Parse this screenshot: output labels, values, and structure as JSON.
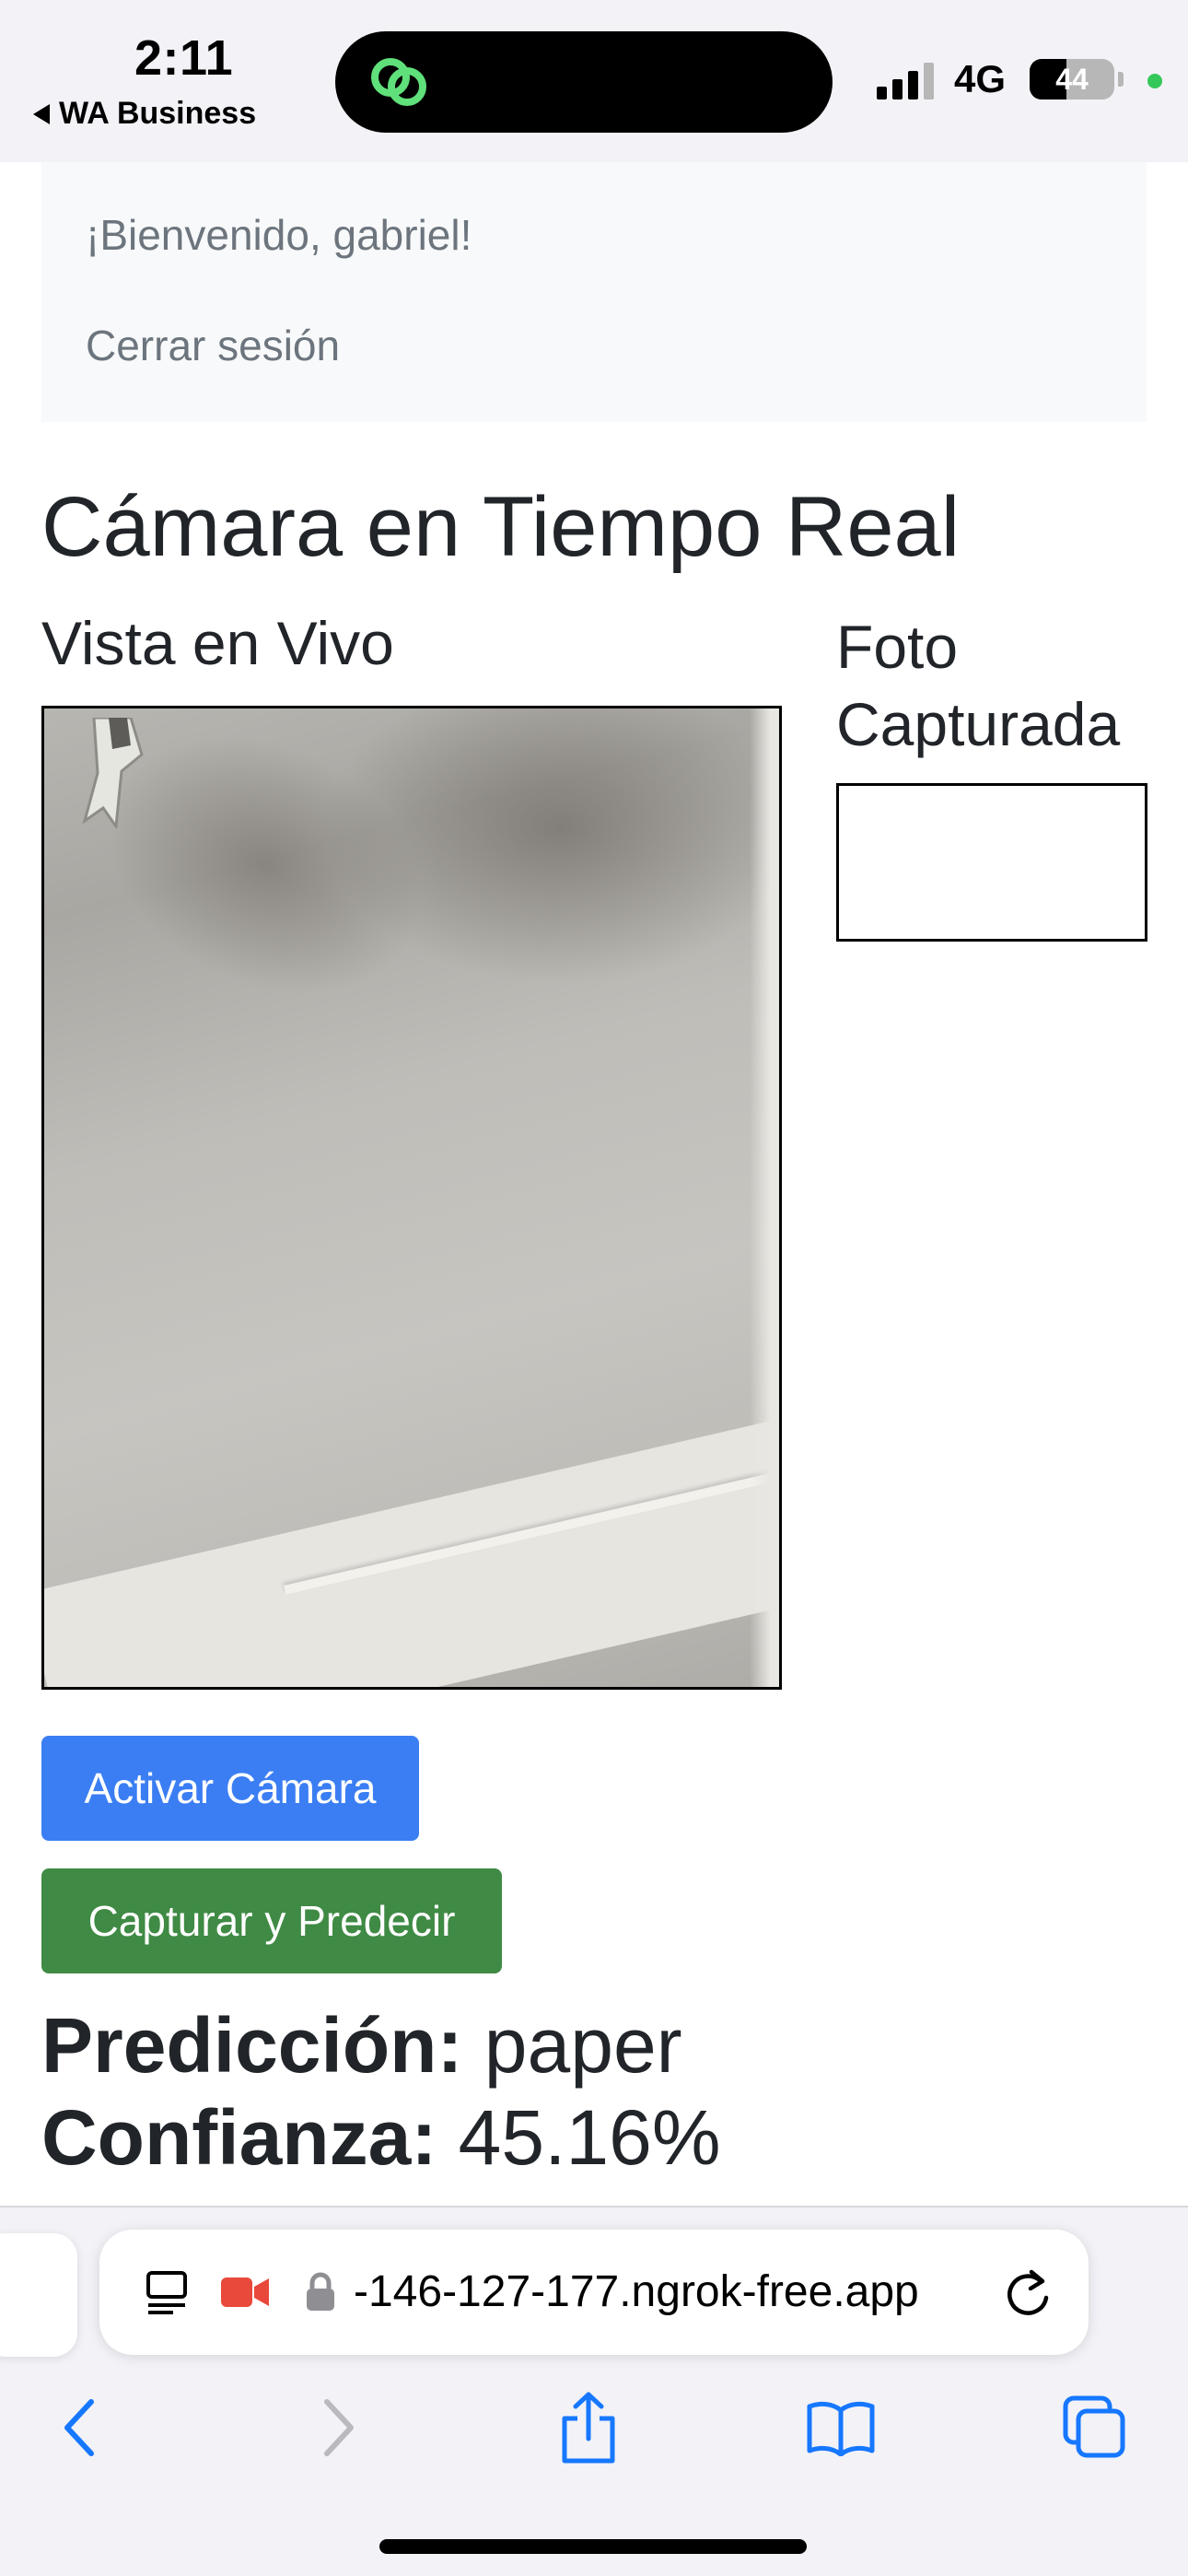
{
  "status_bar": {
    "time": "2:11",
    "back_app": "WA Business",
    "network": "4G",
    "battery_percent": "44",
    "battery_level": 0.44
  },
  "nav": {
    "welcome": "¡Bienvenido, gabriel!",
    "logout": "Cerrar sesión"
  },
  "main": {
    "title": "Cámara en Tiempo Real",
    "live_view_heading": "Vista en Vivo",
    "captured_heading": "Foto Capturada",
    "activate_button": "Activar Cámara",
    "capture_button": "Capturar y Predecir",
    "prediction_label": "Predicción:",
    "prediction_value": "paper",
    "confidence_label": "Confianza:",
    "confidence_value": "45.16%"
  },
  "browser": {
    "url": "-146-127-177.ngrok-free.app",
    "icons": [
      "page-menu-icon",
      "camera-recording-icon",
      "lock-icon",
      "reload-icon",
      "back-icon",
      "forward-icon",
      "share-icon",
      "bookmarks-icon",
      "tabs-icon"
    ]
  },
  "colors": {
    "primary": "#3b7ef3",
    "success": "#3f8a44",
    "recording": "#e8493b",
    "ios_blue": "#1677ff",
    "green_dot": "#34c759"
  }
}
